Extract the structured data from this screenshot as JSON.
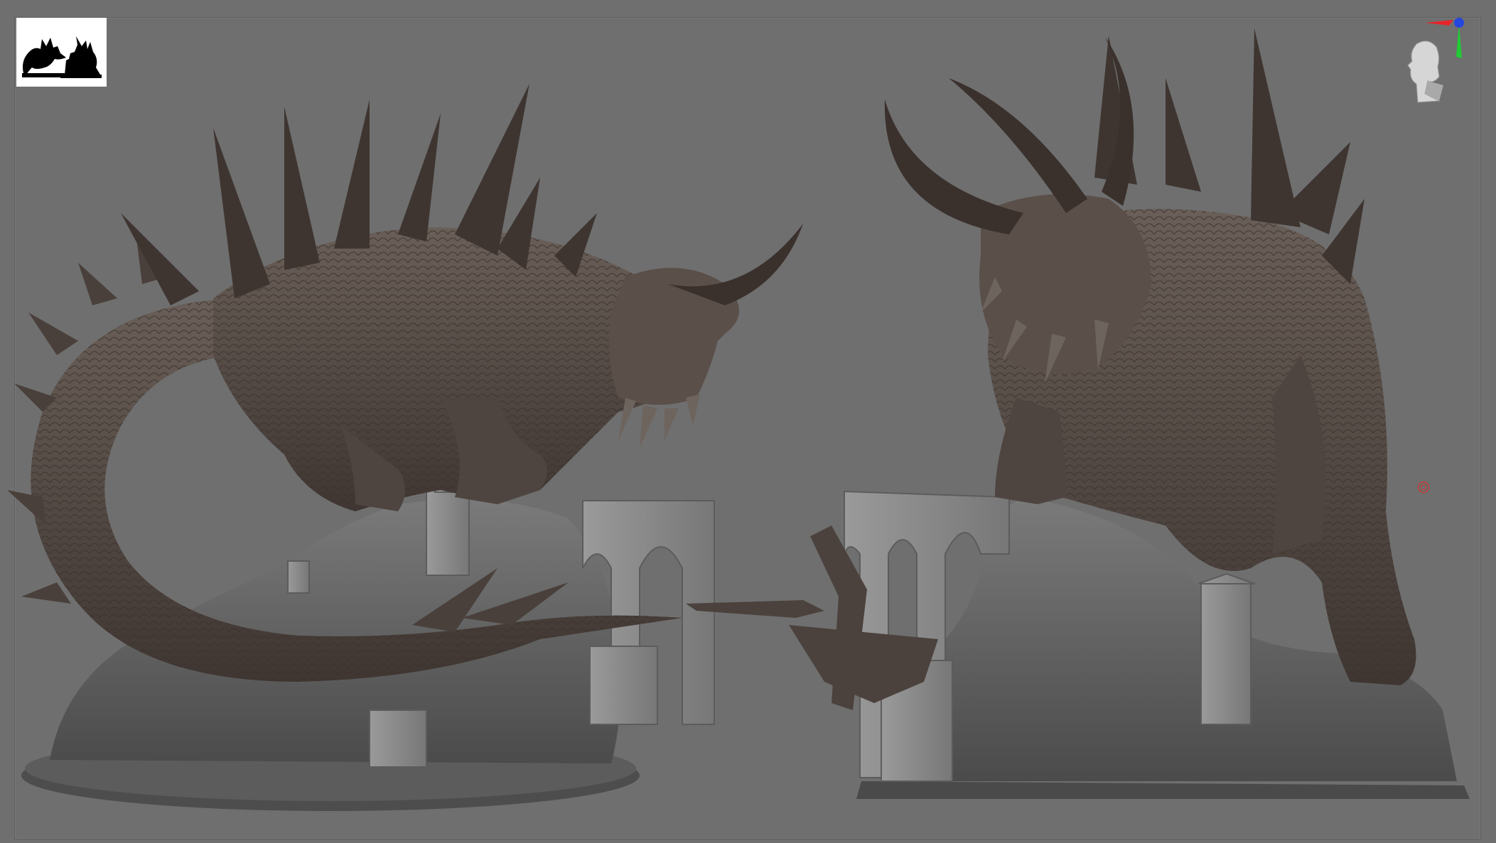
{
  "app": {
    "view": "3d-viewport",
    "background_color": "#6f6f6f",
    "model_color": "#554b46",
    "base_color": "#5a5a5a"
  },
  "thumbnail": {
    "icon": "thumbnail-icon",
    "background_color": "#ffffff"
  },
  "navigation": {
    "icon": "navigation-head-icon",
    "axis_colors": {
      "x": "#e8242a",
      "y": "#1fcc35",
      "z": "#2646e0"
    }
  },
  "focus": {
    "icon": "focus-ring-icon",
    "color": "#c23a34"
  },
  "models": [
    {
      "id": "dragon-left",
      "icon": "dragon-sculpt-icon"
    },
    {
      "id": "beast-right",
      "icon": "horned-beast-sculpt-icon"
    }
  ]
}
